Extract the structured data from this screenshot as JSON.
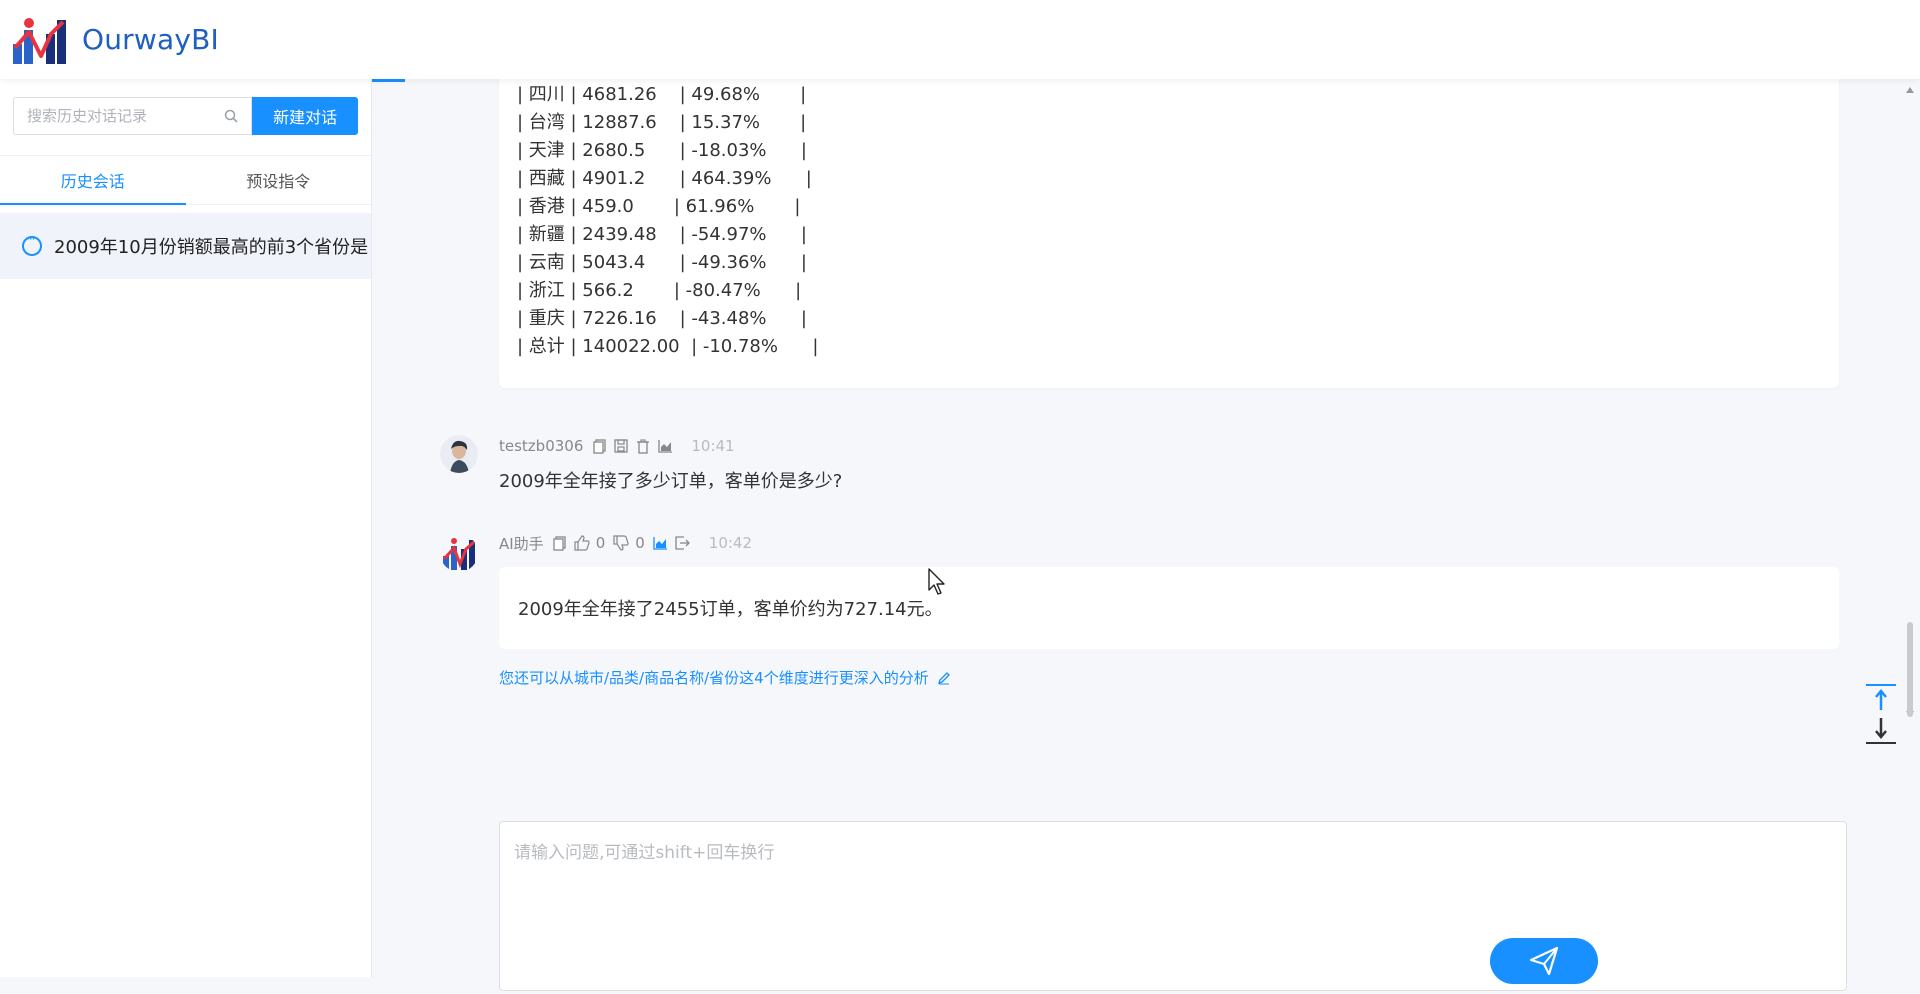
{
  "app": {
    "logo_text": "OurwayBI"
  },
  "sidebar": {
    "search_placeholder": "搜索历史对话记录",
    "new_chat_label": "新建对话",
    "tabs": [
      {
        "label": "历史会话",
        "active": true
      },
      {
        "label": "预设指令",
        "active": false
      }
    ],
    "history": [
      {
        "title": "2009年10月份销额最高的前3个省份是"
      }
    ]
  },
  "table": {
    "rows": [
      {
        "line": "| 四川 | 4681.26    | 49.68%       |"
      },
      {
        "line": "| 台湾 | 12887.6    | 15.37%       |"
      },
      {
        "line": "| 天津 | 2680.5      | -18.03%      |"
      },
      {
        "line": "| 西藏 | 4901.2      | 464.39%      |"
      },
      {
        "line": "| 香港 | 459.0       | 61.96%       |"
      },
      {
        "line": "| 新疆 | 2439.48    | -54.97%      |"
      },
      {
        "line": "| 云南 | 5043.4      | -49.36%      |"
      },
      {
        "line": "| 浙江 | 566.2       | -80.47%      |"
      },
      {
        "line": "| 重庆 | 7226.16    | -43.48%      |"
      },
      {
        "line": "| 总计 | 140022.00  | -10.78%      |"
      }
    ]
  },
  "user_message": {
    "name": "testzb0306",
    "time": "10:41",
    "text": "2009年全年接了多少订单，客单价是多少?"
  },
  "ai_message": {
    "name": "AI助手",
    "likes": "0",
    "dislikes": "0",
    "time": "10:42",
    "text": "2009年全年接了2455订单，客单价约为727.14元。",
    "suggestion": "您还可以从城市/品类/商品名称/省份这4个维度进行更深入的分析"
  },
  "input": {
    "placeholder": "请输入问题,可通过shift+回车换行"
  },
  "colors": {
    "accent": "#1890ff",
    "logo": "#1f5fbf"
  }
}
